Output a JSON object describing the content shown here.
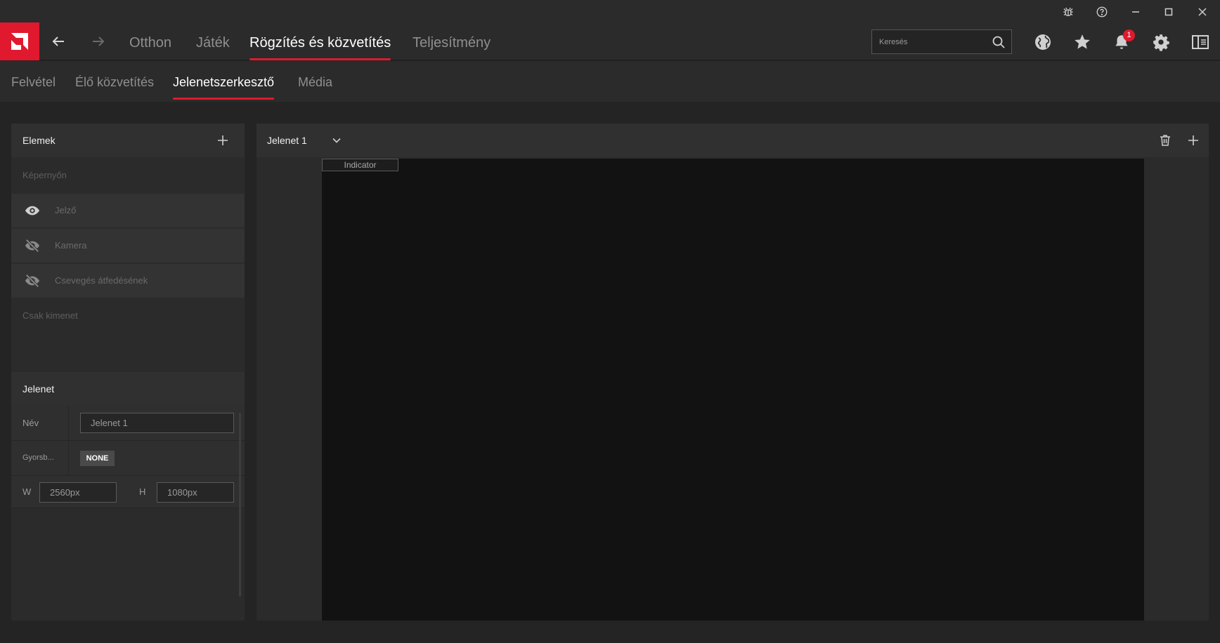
{
  "window_controls": {
    "bug": "bug-icon",
    "help": "help-icon",
    "minimize": "minimize-icon",
    "maximize": "maximize-icon",
    "close": "close-icon"
  },
  "header": {
    "logo": "amd-logo",
    "back": "back-arrow-icon",
    "forward": "forward-arrow-icon",
    "tabs": [
      {
        "label": "Otthon",
        "active": false
      },
      {
        "label": "Játék",
        "active": false
      },
      {
        "label": "Rögzítés és közvetítés",
        "active": true
      },
      {
        "label": "Teljesítmény",
        "active": false
      }
    ],
    "search": {
      "placeholder": "Keresés",
      "value": ""
    },
    "notification_count": "1",
    "accent_color": "#e0192e"
  },
  "subnav": {
    "tabs": [
      {
        "label": "Felvétel",
        "active": false
      },
      {
        "label": "Élő közvetítés",
        "active": false
      },
      {
        "label": "Jelenetszerkesztő",
        "active": true
      },
      {
        "label": "Média",
        "active": false
      }
    ]
  },
  "elements_panel": {
    "title": "Elemek",
    "on_screen_label": "Képernyőn",
    "items": [
      {
        "label": "Jelző",
        "visible": true
      },
      {
        "label": "Kamera",
        "visible": false
      },
      {
        "label": "Csevegés átfedésének",
        "visible": false
      }
    ],
    "output_only_label": "Csak kimenet"
  },
  "scene_panel": {
    "title": "Jelenet",
    "name_label": "Név",
    "name_value": "Jelenet 1",
    "hotkey_label": "Gyorsb...",
    "hotkey_value": "NONE",
    "width_label": "W",
    "width_value": "2560px",
    "height_label": "H",
    "height_value": "1080px"
  },
  "main": {
    "scene_name": "Jelenet 1",
    "indicator_label": "Indicator"
  }
}
